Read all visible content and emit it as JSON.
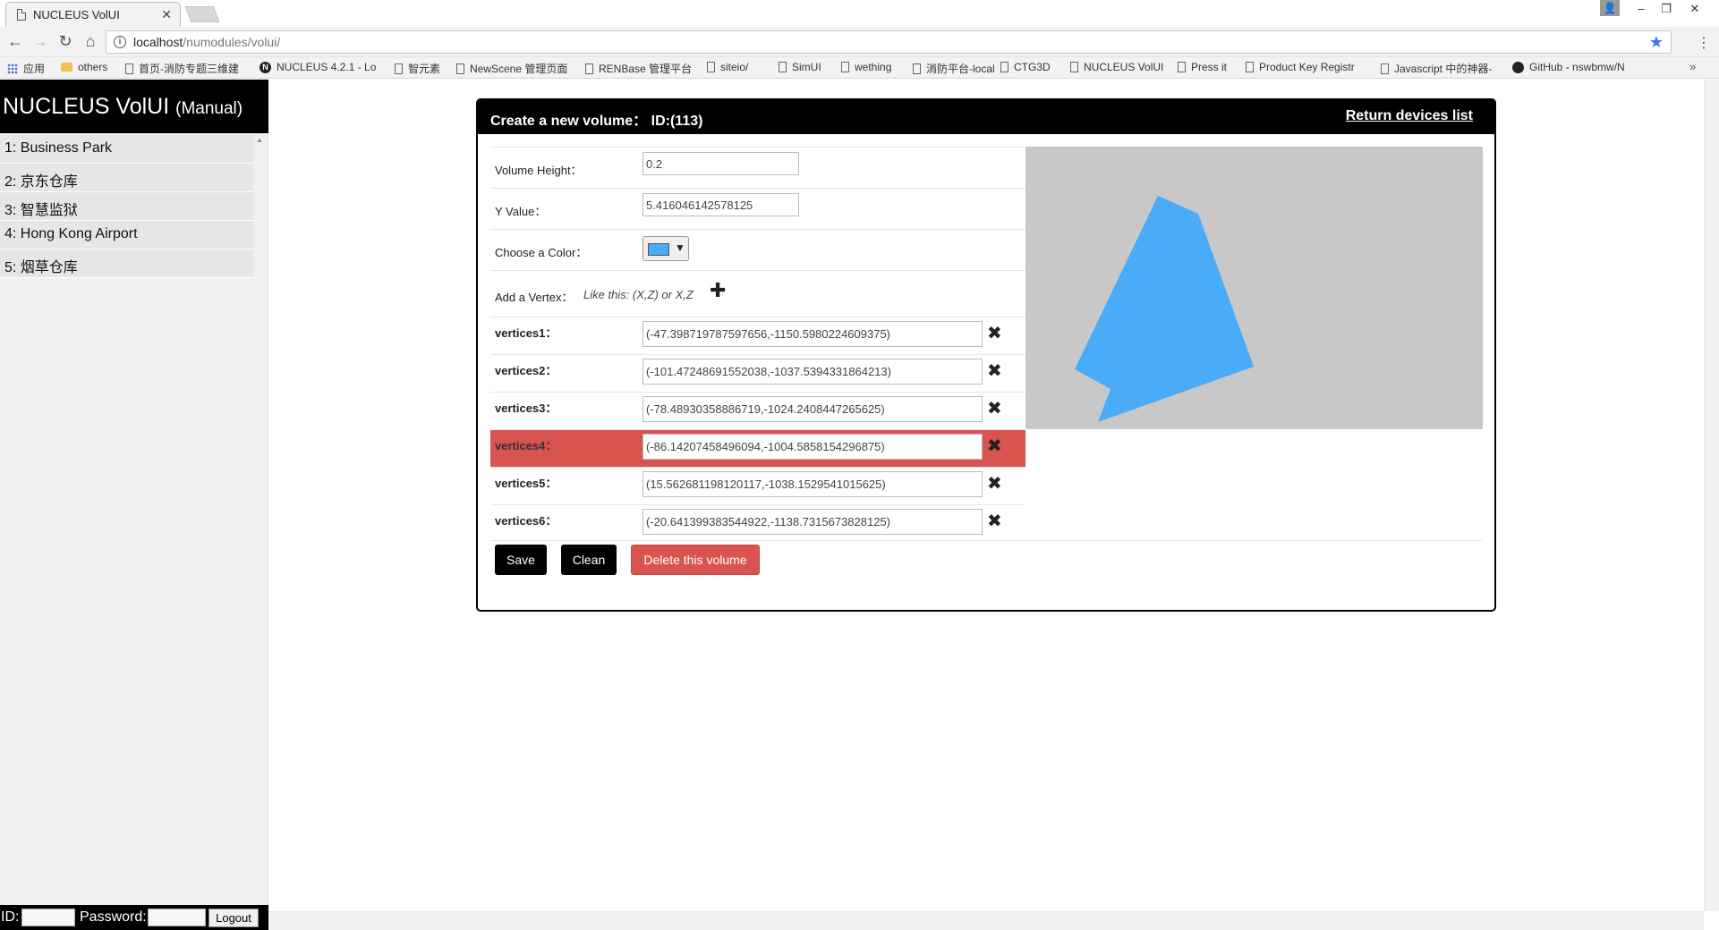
{
  "browser": {
    "tab_title": "NUCLEUS VolUI",
    "url_host": "localhost",
    "url_path": "/numodules/volui/",
    "bookmarks": [
      {
        "label": "应用",
        "icon": "apps-grid-icon"
      },
      {
        "label": "others",
        "icon": "folder-icon"
      },
      {
        "label": "首页-消防专题三维建",
        "icon": "page-icon"
      },
      {
        "label": "NUCLEUS 4.2.1 - Lo",
        "icon": "nucleus-icon"
      },
      {
        "label": "智元素",
        "icon": "page-icon"
      },
      {
        "label": "NewScene 管理页面",
        "icon": "page-icon"
      },
      {
        "label": "RENBase 管理平台",
        "icon": "page-icon"
      },
      {
        "label": "siteio/",
        "icon": "page-icon"
      },
      {
        "label": "SimUI",
        "icon": "page-icon"
      },
      {
        "label": "wething",
        "icon": "page-icon"
      },
      {
        "label": "消防平台-local",
        "icon": "page-icon"
      },
      {
        "label": "CTG3D",
        "icon": "page-icon"
      },
      {
        "label": "NUCLEUS VolUI",
        "icon": "page-icon"
      },
      {
        "label": "Press it",
        "icon": "page-icon"
      },
      {
        "label": "Product Key Registr",
        "icon": "page-icon"
      },
      {
        "label": "Javascript 中的神器-",
        "icon": "page-icon"
      },
      {
        "label": "GitHub - nswbmw/N",
        "icon": "github-icon"
      }
    ]
  },
  "sidebar": {
    "brand": "NUCLEUS VolUI",
    "brand_mode": "(Manual)",
    "devices": [
      {
        "label": "1: Business Park"
      },
      {
        "label": "2: 京东仓库"
      },
      {
        "label": "3: 智慧监狱"
      },
      {
        "label": "4: Hong Kong Airport"
      },
      {
        "label": "5: 烟草仓库"
      }
    ],
    "login": {
      "id_label": "ID:",
      "password_label": "Password:",
      "logout_label": "Logout"
    }
  },
  "panel": {
    "title_prefix": "Create a new volume：",
    "title_id": "ID:(113)",
    "return_link": "Return devices list",
    "volume_height_label": "Volume Height：",
    "volume_height_value": "0.2",
    "y_value_label": "Y Value：",
    "y_value_value": "5.416046142578125",
    "color_label": "Choose a Color：",
    "color_value": "#4aabf8",
    "add_vertex_label": "Add a Vertex：",
    "add_vertex_hint": "Like this: (X,Z) or X,Z",
    "vertices": [
      {
        "label": "vertices1：",
        "value": "(-47.398719787597656,-1150.5980224609375)"
      },
      {
        "label": "vertices2：",
        "value": "(-101.47248691552038,-1037.5394331864213)"
      },
      {
        "label": "vertices3：",
        "value": "(-78.48930358886719,-1024.2408447265625)"
      },
      {
        "label": "vertices4：",
        "value": "(-86.14207458496094,-1004.5858154296875)"
      },
      {
        "label": "vertices5：",
        "value": "(15.562681198120117,-1038.1529541015625)"
      },
      {
        "label": "vertices6：",
        "value": "(-20.641399383544922,-1138.7315673828125)"
      }
    ],
    "active_vertex_index": 3,
    "buttons": {
      "save": "Save",
      "clean": "Clean",
      "delete": "Delete this volume"
    },
    "preview": {
      "background": "#c8c8c8",
      "fill": "#4aabf8"
    }
  }
}
